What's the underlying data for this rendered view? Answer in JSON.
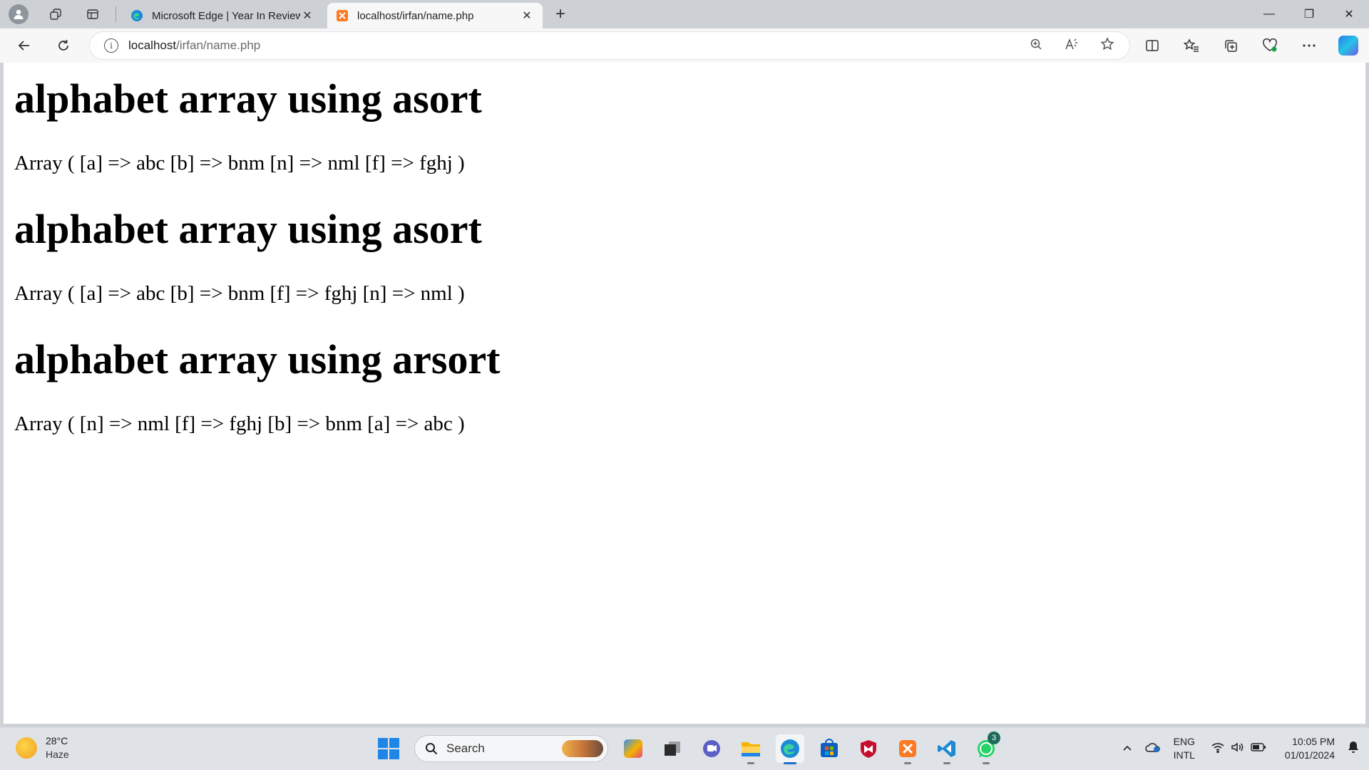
{
  "browser": {
    "tabs": [
      {
        "title": "Microsoft Edge | Year In Review",
        "close": "✕",
        "active": false
      },
      {
        "title": "localhost/irfan/name.php",
        "close": "✕",
        "active": true
      }
    ],
    "new_tab": "+",
    "window_controls": {
      "minimize": "—",
      "restore": "❐",
      "close": "✕"
    },
    "address": {
      "host": "localhost",
      "path": "/irfan/name.php"
    },
    "icons": [
      "profile-icon",
      "workspaces-icon",
      "vertical-tabs-icon",
      "back-icon",
      "refresh-icon",
      "info-icon",
      "zoom-icon",
      "read-aloud-icon",
      "favorite-star-icon",
      "split-screen-icon",
      "favorites-icon",
      "collections-icon",
      "browser-essentials-icon",
      "more-icon",
      "copilot-icon"
    ]
  },
  "page": {
    "sections": [
      {
        "heading": "alphabet array using asort",
        "output": "Array ( [a] => abc [b] => bnm [n] => nml [f] => fghj )"
      },
      {
        "heading": "alphabet array using asort",
        "output": "Array ( [a] => abc [b] => bnm [f] => fghj [n] => nml )"
      },
      {
        "heading": "alphabet array using arsort",
        "output": "Array ( [n] => nml [f] => fghj [b] => bnm [a] => abc )"
      }
    ]
  },
  "taskbar": {
    "weather": {
      "temp": "28°C",
      "condition": "Haze"
    },
    "search_label": "Search",
    "apps": [
      "copilot-pre",
      "task-view",
      "teams-chat",
      "file-explorer",
      "edge",
      "microsoft-store",
      "mcafee",
      "xampp",
      "vscode",
      "whatsapp"
    ],
    "whatsapp_badge": "3",
    "language": {
      "line1": "ENG",
      "line2": "INTL"
    },
    "clock": {
      "time": "10:05 PM",
      "date": "01/01/2024"
    },
    "colors": {
      "accent": "#1f6fc8",
      "windows_blue": "#1f86e8"
    }
  }
}
